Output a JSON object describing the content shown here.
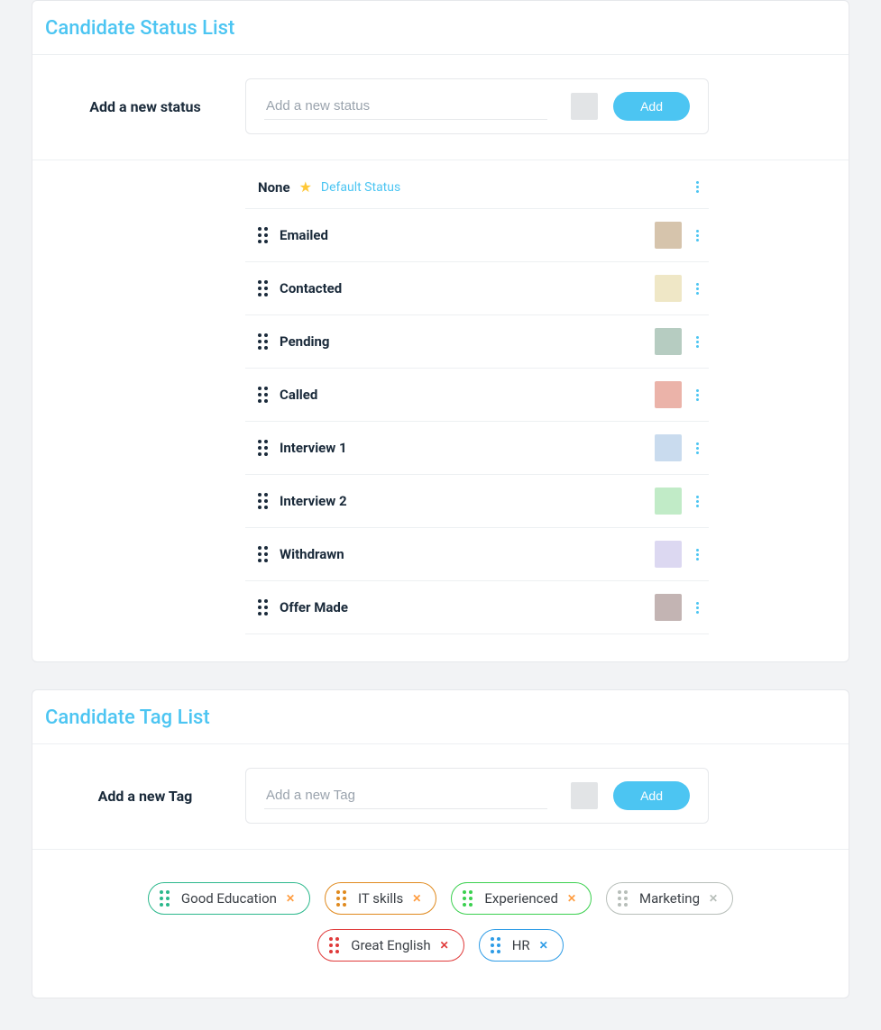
{
  "status_card": {
    "title": "Candidate Status List",
    "add_label": "Add a new status",
    "add_placeholder": "Add a new status",
    "add_button": "Add",
    "default_item": {
      "label": "None",
      "default_text": "Default Status"
    },
    "items": [
      {
        "label": "Emailed",
        "color": "#d6c4ac"
      },
      {
        "label": "Contacted",
        "color": "#efe7c6"
      },
      {
        "label": "Pending",
        "color": "#b6ccc1"
      },
      {
        "label": "Called",
        "color": "#ebb3a9"
      },
      {
        "label": "Interview 1",
        "color": "#c9dbee"
      },
      {
        "label": "Interview 2",
        "color": "#c1ebc7"
      },
      {
        "label": "Withdrawn",
        "color": "#dcd8f1"
      },
      {
        "label": "Offer Made",
        "color": "#c3b4b3"
      }
    ]
  },
  "tag_card": {
    "title": "Candidate Tag List",
    "add_label": "Add a new Tag",
    "add_placeholder": "Add a new Tag",
    "add_button": "Add",
    "items": [
      {
        "label": "Good Education",
        "border": "#2bb88c",
        "accent": "#2bb88c",
        "close": "#ff9c3f"
      },
      {
        "label": "IT skills",
        "border": "#e08a1e",
        "accent": "#e08a1e",
        "close": "#ff9c3f"
      },
      {
        "label": "Experienced",
        "border": "#3bd04f",
        "accent": "#3bd04f",
        "close": "#ff9c3f"
      },
      {
        "label": "Marketing",
        "border": "#b7beb9",
        "accent": "#b7beb9",
        "close": "#b7beb9"
      },
      {
        "label": "Great English",
        "border": "#e03a3a",
        "accent": "#e03a3a",
        "close": "#e03a3a"
      },
      {
        "label": "HR",
        "border": "#2e9ce6",
        "accent": "#2e9ce6",
        "close": "#2e9ce6"
      }
    ]
  }
}
